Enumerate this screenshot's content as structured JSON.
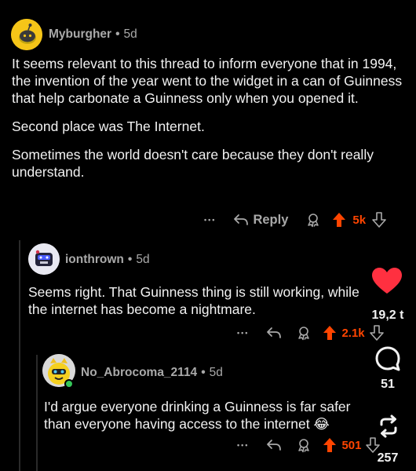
{
  "comments": [
    {
      "username": "Myburgher",
      "separator": "•",
      "age": "5d",
      "paragraphs": [
        "It seems relevant to this thread to inform everyone that in 1994, the invention of the year went to the widget in a can of Guinness that help carbonate a Guinness only when you opened it.",
        "Second place was The Internet.",
        "Sometimes the world doesn't care because they don't really understand."
      ],
      "more": "•••",
      "reply_label": "Reply",
      "score": "5k"
    },
    {
      "username": "ionthrown",
      "separator": "•",
      "age": "5d",
      "paragraphs": [
        "Seems right. That Guinness thing is still working, while the internet has become a nightmare."
      ],
      "more": "•••",
      "score": "2.1k"
    },
    {
      "username": "No_Abrocoma_2114",
      "separator": "•",
      "age": "5d",
      "paragraphs": [
        "I'd argue everyone drinking a Guinness is far safer than everyone having access to the internet 😂"
      ],
      "more": "•••",
      "score": "501"
    }
  ],
  "side_rail": {
    "likes": "19,2 t",
    "comments": "51",
    "reposts": "257"
  },
  "colors": {
    "upvote": "#ff4500",
    "like_heart": "#ff3040",
    "muted": "#a9a9a9",
    "background": "#000000"
  }
}
